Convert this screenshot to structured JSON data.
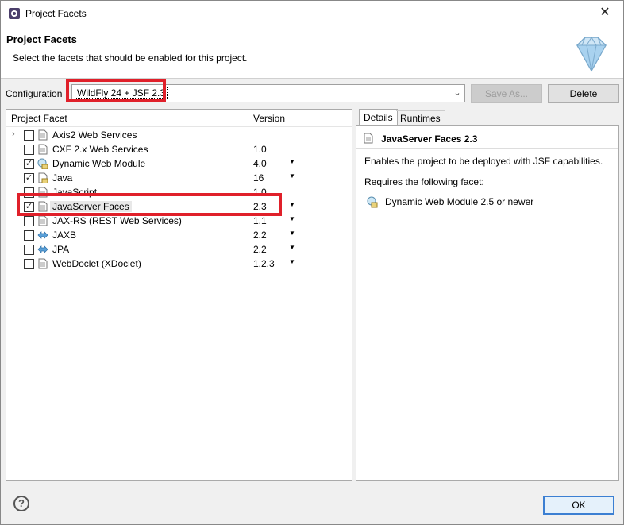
{
  "window": {
    "title": "Project Facets",
    "close_glyph": "✕"
  },
  "banner": {
    "title": "Project Facets",
    "description": "Select the facets that should be enabled for this project."
  },
  "config": {
    "label": "onfiguration",
    "label_mnemonic": "C",
    "value": "WildFly 24 + JSF 2.3",
    "save_as": "Save As...",
    "delete": "Delete"
  },
  "table": {
    "headers": {
      "facet": "Project Facet",
      "version": "Version"
    },
    "rows": [
      {
        "label": "Axis2 Web Services",
        "version": "",
        "checked": false,
        "expander": true,
        "icon": "page-icon",
        "dropdown": false
      },
      {
        "label": "CXF 2.x Web Services",
        "version": "1.0",
        "checked": false,
        "expander": false,
        "icon": "page-icon",
        "dropdown": false
      },
      {
        "label": "Dynamic Web Module",
        "version": "4.0",
        "checked": true,
        "expander": false,
        "icon": "web-module-lock-icon",
        "dropdown": true
      },
      {
        "label": "Java",
        "version": "16",
        "checked": true,
        "expander": false,
        "icon": "java-lock-icon",
        "dropdown": true
      },
      {
        "label": "JavaScript",
        "version": "1.0",
        "checked": false,
        "expander": false,
        "icon": "page-icon",
        "dropdown": false
      },
      {
        "label": "JavaServer Faces",
        "version": "2.3",
        "checked": true,
        "expander": false,
        "icon": "page-icon",
        "dropdown": true,
        "selected": true
      },
      {
        "label": "JAX-RS (REST Web Services)",
        "version": "1.1",
        "checked": false,
        "expander": false,
        "icon": "page-icon",
        "dropdown": true
      },
      {
        "label": "JAXB",
        "version": "2.2",
        "checked": false,
        "expander": false,
        "icon": "arrows-icon",
        "dropdown": true
      },
      {
        "label": "JPA",
        "version": "2.2",
        "checked": false,
        "expander": false,
        "icon": "arrows-icon",
        "dropdown": true
      },
      {
        "label": "WebDoclet (XDoclet)",
        "version": "1.2.3",
        "checked": false,
        "expander": false,
        "icon": "page-icon",
        "dropdown": true
      }
    ]
  },
  "details": {
    "tabs": [
      "Details",
      "Runtimes"
    ],
    "title": "JavaServer Faces 2.3",
    "description": "Enables the project to be deployed with JSF capabilities.",
    "requires_label": "Requires the following facet:",
    "requirement": "Dynamic Web Module 2.5 or newer"
  },
  "footer": {
    "help": "?",
    "ok": "OK"
  },
  "colors": {
    "highlight": "#e0202a",
    "ok_border": "#3c7fd2"
  }
}
